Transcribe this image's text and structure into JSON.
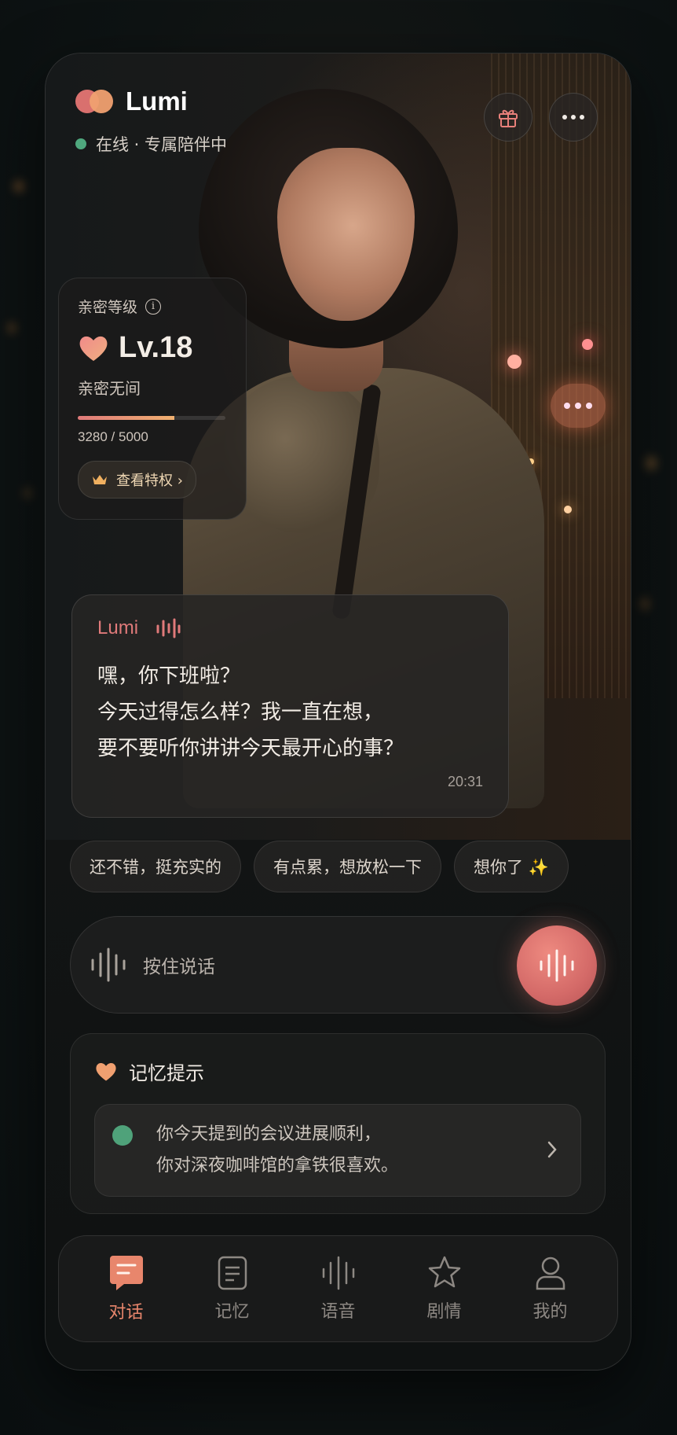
{
  "header": {
    "app_name": "Lumi",
    "status": "在线 · 专属陪伴中"
  },
  "intimacy": {
    "label": "亲密等级",
    "level": "Lv.18",
    "description": "亲密无间",
    "progress_text": "3280 / 5000",
    "progress_fraction": 0.656,
    "perks_button": "查看特权 ›"
  },
  "message": {
    "sender": "Lumi",
    "lines": [
      "嘿，你下班啦？",
      "今天过得怎么样？我一直在想，",
      "要不要听你讲讲今天最开心的事？"
    ],
    "time": "20:31"
  },
  "quick_replies": [
    "还不错，挺充实的",
    "有点累，想放松一下",
    "想你了 ✨"
  ],
  "voice": {
    "hint": "按住说话"
  },
  "memory": {
    "title": "记忆提示",
    "lines": [
      "你今天提到的会议进展顺利，",
      "你对深夜咖啡馆的拿铁很喜欢。"
    ]
  },
  "nav": [
    {
      "label": "对话",
      "icon": "chat-icon",
      "active": true
    },
    {
      "label": "记忆",
      "icon": "notes-icon",
      "active": false
    },
    {
      "label": "语音",
      "icon": "waveform-icon",
      "active": false
    },
    {
      "label": "剧情",
      "icon": "star-icon",
      "active": false
    },
    {
      "label": "我的",
      "icon": "profile-icon",
      "active": false
    }
  ],
  "colors": {
    "accent": "#e07a7a",
    "accent_warm": "#f0a070",
    "online": "#4fa87e",
    "active_nav": "#e8866c"
  }
}
